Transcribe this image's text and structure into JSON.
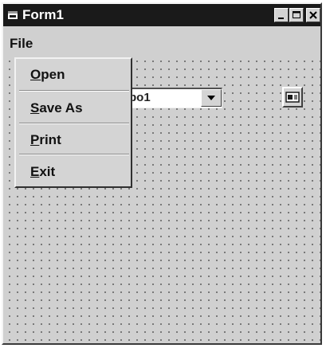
{
  "window": {
    "title": "Form1",
    "minimize_glyph": "_",
    "maximize_glyph": "□",
    "close_glyph": "x"
  },
  "menubar": {
    "file_label": "File"
  },
  "file_menu": {
    "items": [
      {
        "label": "Open",
        "mnemonic": "O"
      },
      {
        "label": "Save As",
        "mnemonic": "S"
      },
      {
        "label": "Print",
        "mnemonic": "P"
      },
      {
        "label": "Exit",
        "mnemonic": "E"
      }
    ]
  },
  "combo": {
    "visible_text": "bo1",
    "icon": "chevron-down-icon"
  },
  "toolbox_control": {
    "icon": "combo-control-icon"
  },
  "colors": {
    "titlebar": "#1a1a1a",
    "face": "#d0d0d0",
    "grid_dot": "#6a6a6a"
  }
}
